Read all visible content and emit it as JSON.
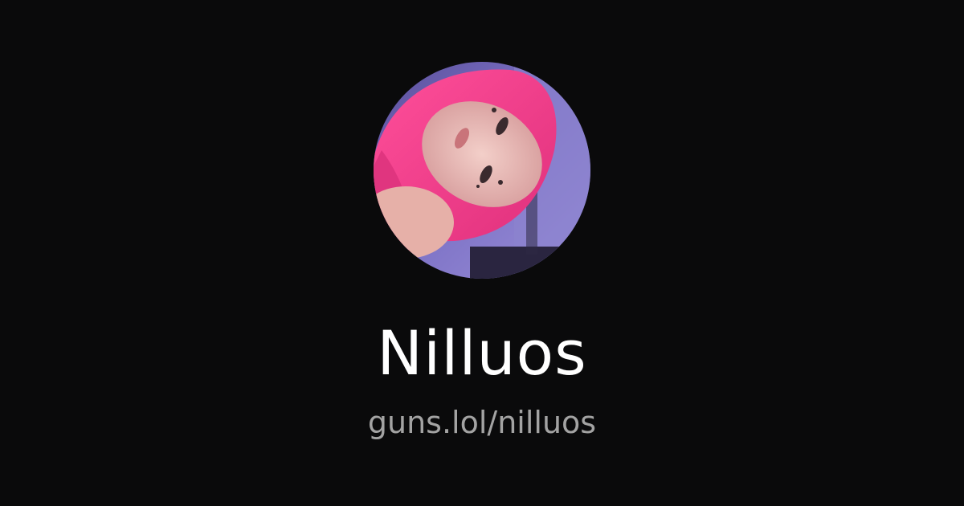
{
  "profile": {
    "display_name": "Nilluos",
    "url": "guns.lol/nilluos",
    "avatar": "profile-photo"
  },
  "colors": {
    "background": "#0a0a0b",
    "name_text": "#ffffff",
    "url_text": "#a3a3a3"
  }
}
